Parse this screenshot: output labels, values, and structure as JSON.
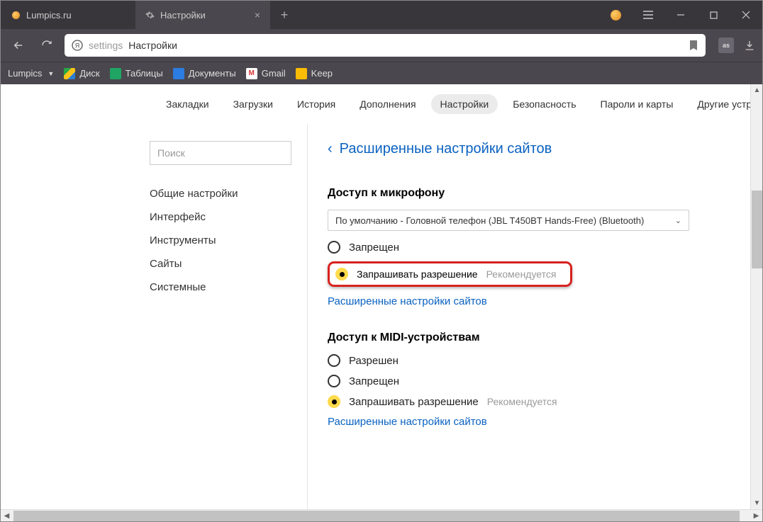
{
  "tabs": [
    {
      "title": "Lumpics.ru"
    },
    {
      "title": "Настройки"
    }
  ],
  "omnibox": {
    "prefix": "settings",
    "title": "Настройки"
  },
  "bookmarks": {
    "folder": "Lumpics",
    "disk": "Диск",
    "sheets": "Таблицы",
    "docs": "Документы",
    "gmail": "Gmail",
    "keep": "Keep"
  },
  "nav": {
    "bookmarks": "Закладки",
    "downloads": "Загрузки",
    "history": "История",
    "addons": "Дополнения",
    "settings": "Настройки",
    "security": "Безопасность",
    "passwords": "Пароли и карты",
    "other": "Другие устро"
  },
  "sidebar": {
    "search_placeholder": "Поиск",
    "items": [
      "Общие настройки",
      "Интерфейс",
      "Инструменты",
      "Сайты",
      "Системные"
    ]
  },
  "main": {
    "backlink": "Расширенные настройки сайтов",
    "mic": {
      "heading": "Доступ к микрофону",
      "select": "По умолчанию - Головной телефон (JBL T450BT Hands-Free) (Bluetooth)",
      "opt_deny": "Запрещен",
      "opt_ask": "Запрашивать разрешение",
      "reco": "Рекомендуется",
      "link": "Расширенные настройки сайтов"
    },
    "midi": {
      "heading": "Доступ к MIDI-устройствам",
      "opt_allow": "Разрешен",
      "opt_deny": "Запрещен",
      "opt_ask": "Запрашивать разрешение",
      "reco": "Рекомендуется",
      "link": "Расширенные настройки сайтов"
    }
  }
}
